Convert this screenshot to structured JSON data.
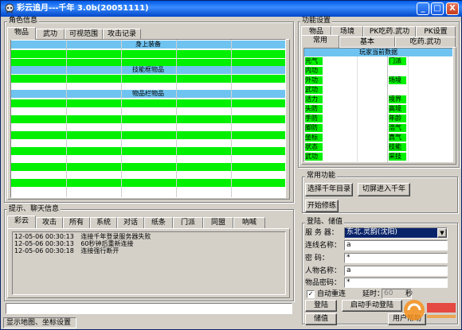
{
  "window": {
    "title": "彩云追月---千年 3.0b(20051111)",
    "min_label": "_",
    "max_label": "□",
    "close_label": "X"
  },
  "character": {
    "group_label": "角色信息",
    "tabs": [
      "物品",
      "武功",
      "可视范围",
      "攻击记录"
    ],
    "section_equip": "身上装备",
    "section_skill": "技能框物品",
    "section_bag": "物品栏物品"
  },
  "function_settings": {
    "group_label": "功能设置",
    "tabs_row1": [
      "物品",
      "场境",
      "PK吃药.武功",
      "PK设置"
    ],
    "tabs_row2": [
      "常用",
      "基本",
      "吃药.武功"
    ],
    "player_data_header": "玩家当前数据",
    "left_stats": [
      "元气",
      "内功",
      "外功",
      "武功",
      "活力",
      "头防",
      "手防",
      "脚防",
      "坐标",
      "状态",
      "武功"
    ],
    "right_stats": [
      "门派",
      "",
      "场境",
      "",
      "境界",
      "高境",
      "年龄",
      "浩气",
      "真气",
      "技能",
      "采技"
    ]
  },
  "common_functions": {
    "group_label": "常用功能",
    "select_year_button": "选择千年目录",
    "switch_year_button": "切屏进入千年",
    "start_button": "开始修练"
  },
  "login": {
    "group_label": "登陆、储值",
    "server_label": "服 务 器：",
    "server_value": "东北.灵韵(沈阳)",
    "account_label": "连线名称：",
    "account_value": "a",
    "password_label": "密    码：",
    "password_value": "*",
    "char_label": "人物名称：",
    "char_value": "a",
    "item_pwd_label": "物品密码：",
    "item_pwd_value": "*",
    "auto_reconnect_label": "自动重连",
    "delay_label": "延时：",
    "delay_value": "60",
    "delay_unit": "秒",
    "login_button": "登陆",
    "start_sync_button": "启动手动登陆",
    "store_button": "储值",
    "user_service_button": "用户帮助"
  },
  "chat": {
    "group_label": "提示、聊天信息",
    "tabs": [
      "彩云",
      "攻击",
      "所有",
      "系统",
      "对话",
      "纸条",
      "门派",
      "同盟",
      "吶喊"
    ],
    "rows": [
      {
        "time": "12-05-06 00:30:13",
        "msg": "连接千年登录服务器失败"
      },
      {
        "time": "12-05-06 00:30:13",
        "msg": "60秒钟后重新连接"
      },
      {
        "time": "12-05-06 00:30:18",
        "msg": "连接强行断开"
      }
    ]
  },
  "status_bar": {
    "text": "显示地图、坐标设置"
  },
  "colors": {
    "green": "#00f000",
    "header_blue": "#6fc3f0",
    "face": "#d4d0c8"
  }
}
